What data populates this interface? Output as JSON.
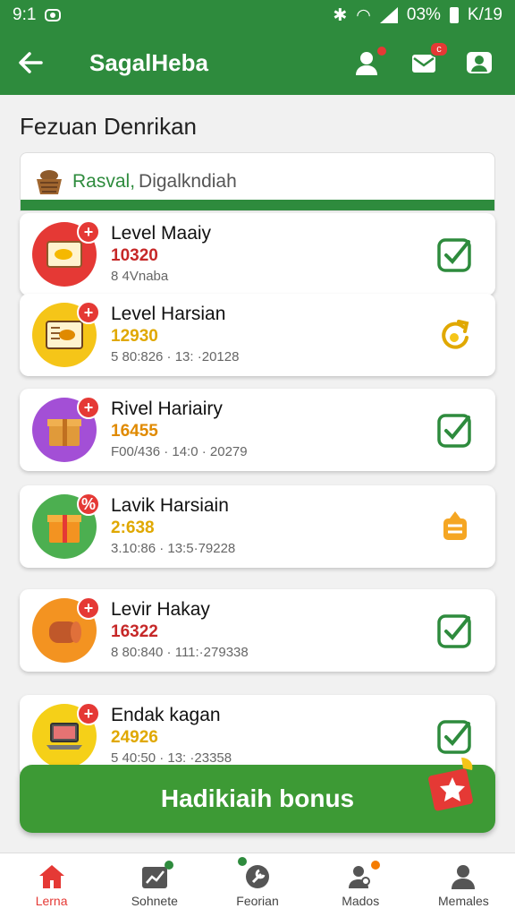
{
  "status_bar": {
    "time": "9:1",
    "battery": "03%",
    "date": "K/19"
  },
  "app_bar": {
    "back_icon": "arrow-left-icon",
    "title": "SagalHeba",
    "actions": [
      "person-alert-icon",
      "envelope-badge-icon",
      "profile-icon"
    ],
    "badge": "c"
  },
  "section": {
    "title": "Fezuan Denrikan"
  },
  "summary": {
    "name": "Rasval,",
    "subtitle": "Digalkndiah"
  },
  "items": [
    {
      "title": "Level Maaiy",
      "points": "10320",
      "meta": "8 4Vnaba",
      "points_color": "#c62828",
      "thumb_color": "#e53935",
      "status": "check-icon"
    },
    {
      "title": "Level Harsian",
      "points": "12930",
      "meta": "5 80:826 · 13: ·20128",
      "points_color": "#e0a800",
      "thumb_color": "#f5c518",
      "status": "refresh-arrow-icon"
    },
    {
      "title": "Rivel Hariairy",
      "points": "16455",
      "meta": "F00/436 · 14:0 · 20279",
      "points_color": "#e08a00",
      "thumb_color": "#a34fd6",
      "status": "check-icon"
    },
    {
      "title": "Lavik Harsiain",
      "points": "2:638",
      "meta": "3.10:86 · 13:5·79228",
      "points_color": "#e0a800",
      "thumb_color": "#4caf50",
      "status": "stack-icon"
    },
    {
      "title": "Levir Hakay",
      "points": "16322",
      "meta": "8 80:840 · 111:·279338",
      "points_color": "#c62828",
      "thumb_color": "#f39321",
      "status": "check-icon"
    },
    {
      "title": "Endak kagan",
      "points": "24926",
      "meta": "5 40:50 · 13: ·23358",
      "points_color": "#e0a800",
      "thumb_color": "#f5d018",
      "status": "check-icon"
    }
  ],
  "bonus_button": {
    "label": "Hadikiaih bonus"
  },
  "bottom_nav": [
    {
      "label": "Lerna",
      "icon": "home-icon",
      "active": true
    },
    {
      "label": "Sohnete",
      "icon": "chart-icon",
      "active": false
    },
    {
      "label": "Feorian",
      "icon": "wrench-icon",
      "active": false
    },
    {
      "label": "Mados",
      "icon": "people-icon",
      "active": false
    },
    {
      "label": "Memales",
      "icon": "person-icon",
      "active": false
    }
  ],
  "colors": {
    "primary": "#2e8b3d",
    "accent": "#e53935"
  }
}
